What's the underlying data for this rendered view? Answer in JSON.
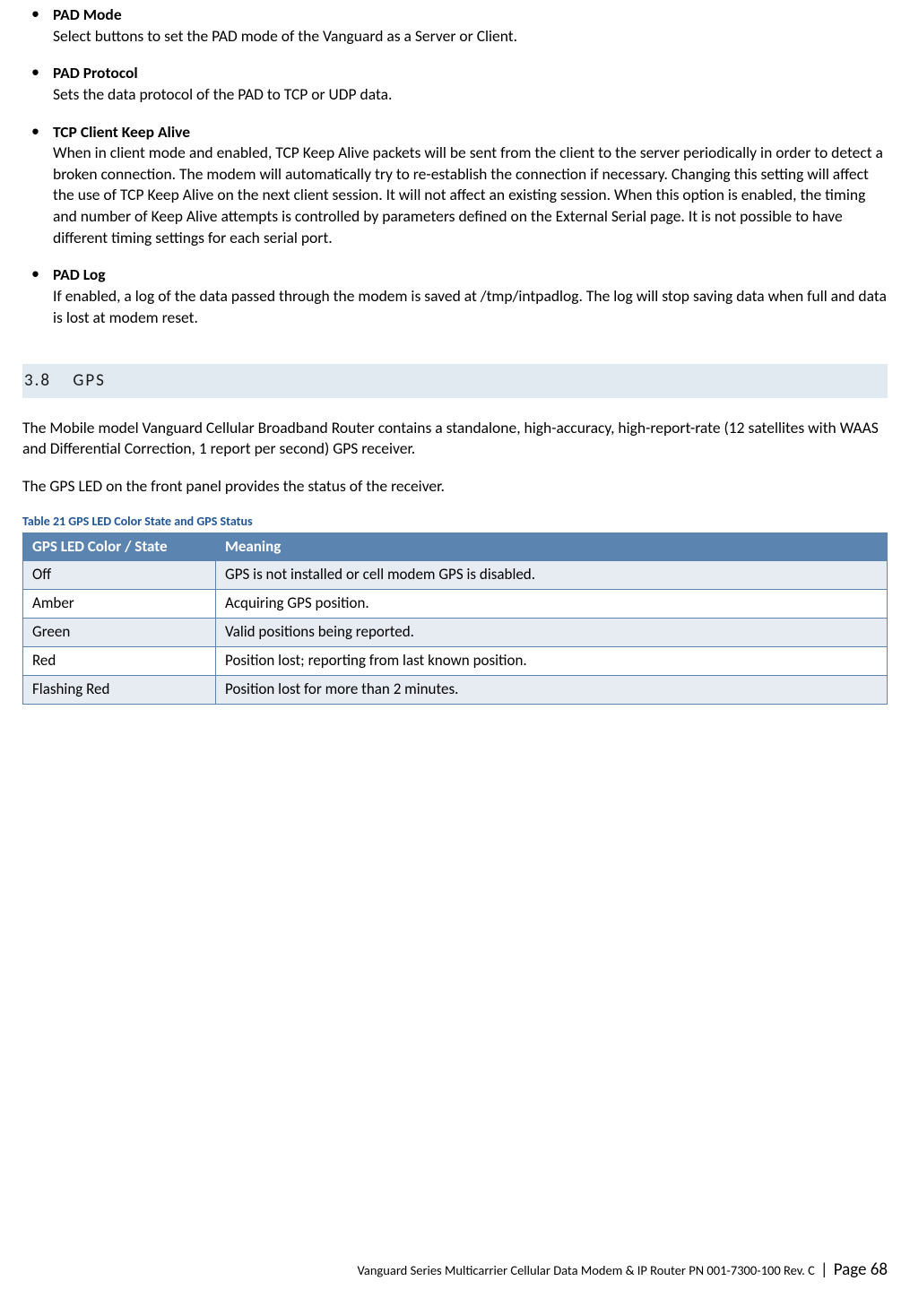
{
  "bullets": [
    {
      "term": "PAD Mode",
      "desc": "Select buttons to set the PAD mode of the Vanguard as a Server or Client."
    },
    {
      "term": "PAD Protocol",
      "desc": "Sets the data protocol of the PAD to TCP or UDP data."
    },
    {
      "term": "TCP Client Keep Alive",
      "desc": "When in client mode and enabled, TCP Keep Alive packets will be sent from the client to the server periodically in order to detect a broken connection. The modem will automatically try to re-establish the connection if necessary. Changing this setting will affect the use of TCP Keep Alive on the next client session. It will not affect an existing session. When this option is enabled, the timing and number of Keep Alive attempts is controlled by parameters defined on the External Serial page. It is not possible to have different timing settings for each serial port."
    },
    {
      "term": "PAD Log",
      "desc": "If enabled, a log of the data passed through the modem is saved at /tmp/intpadlog. The log will stop saving data when full and data is lost at modem reset."
    }
  ],
  "section": {
    "num": "3.8",
    "title": "GPS"
  },
  "paras": [
    "The Mobile model Vanguard Cellular Broadband Router contains a standalone, high-accuracy, high-report-rate (12 satellites with WAAS and Differential Correction, 1 report per second) GPS receiver.",
    "The GPS LED on the front panel provides the status of the receiver."
  ],
  "table": {
    "caption": "Table 21 GPS LED Color State and GPS Status",
    "headers": [
      "GPS LED Color / State",
      "Meaning"
    ],
    "rows": [
      [
        "Off",
        "GPS is not installed or cell modem GPS is disabled."
      ],
      [
        "Amber",
        "Acquiring GPS position."
      ],
      [
        "Green",
        "Valid positions being reported."
      ],
      [
        "Red",
        "Position lost; reporting from last known position."
      ],
      [
        "Flashing Red",
        "Position lost for more than 2 minutes."
      ]
    ]
  },
  "footer": {
    "doc": "Vanguard Series Multicarrier Cellular Data Modem & IP Router PN 001-7300-100 Rev. C",
    "page": "Page 68"
  }
}
